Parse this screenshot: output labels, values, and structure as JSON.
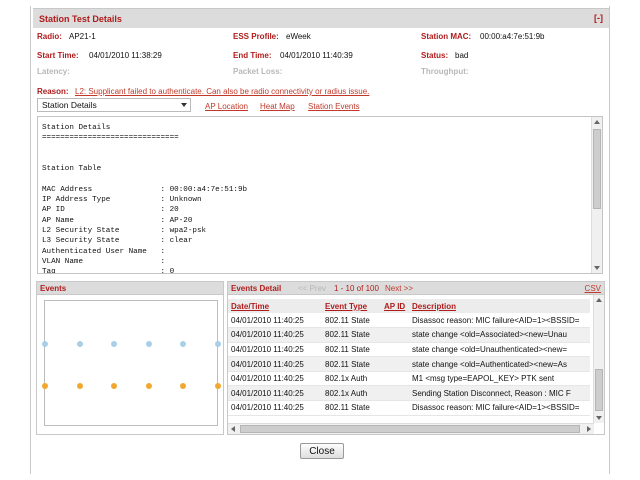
{
  "header": {
    "title": "Station Test Details",
    "collapse": "[-]"
  },
  "info": {
    "radio_label": "Radio:",
    "radio": "AP21-1",
    "ess_label": "ESS Profile:",
    "ess": "eWeek",
    "mac_label": "Station MAC:",
    "mac": "00:00:a4:7e:51:9b",
    "start_label": "Start Time:",
    "start": "04/01/2010 11:38:29",
    "end_label": "End Time:",
    "end": "04/01/2010 11:40:39",
    "status_label": "Status:",
    "status": "bad",
    "latency_label": "Latency:",
    "packet_loss_label": "Packet Loss:",
    "throughput_label": "Throughput:"
  },
  "reason": {
    "label": "Reason:",
    "text": "L2: Supplicant failed to authenticate. Can also be radio connectivity or radius issue."
  },
  "view_select": {
    "value": "Station Details"
  },
  "links": {
    "ap_location": "AP Location",
    "heat_map": "Heat Map",
    "station_events": "Station Events"
  },
  "details_text": "Station Details\n==============================\n\n\nStation Table\n\nMAC Address               : 00:00:a4:7e:51:9b\nIP Address Type           : Unknown\nAP ID                     : 20\nAP Name                   : AP-20\nL2 Security State         : wpa2-psk\nL3 Security State         : clear\nAuthenticated User Name   :\nVLAN Name                 :\nTag                       : 0",
  "events_panel": {
    "title": "Events",
    "rows": [
      {
        "name": "blue",
        "color": "#a9cfe8",
        "count": 6
      },
      {
        "name": "orange",
        "color": "#f0a830",
        "count": 6
      }
    ]
  },
  "events_detail": {
    "title": "Events Detail",
    "prev": "<< Prev",
    "range": "1 - 10 of 100",
    "next": "Next >>",
    "csv": "CSV",
    "columns": [
      "Date/Time",
      "Event Type",
      "AP ID",
      "Description"
    ],
    "rows": [
      [
        "04/01/2010 11:40:25",
        "802.11 State",
        "",
        "Disassoc reason: MIC failure<AID=1><BSSID="
      ],
      [
        "04/01/2010 11:40:25",
        "802.11 State",
        "",
        "state change <old=Associated><new=Unau"
      ],
      [
        "04/01/2010 11:40:25",
        "802.11 State",
        "",
        "state change <old=Unauthenticated><new="
      ],
      [
        "04/01/2010 11:40:25",
        "802.11 State",
        "",
        "state change <old=Authenticated><new=As"
      ],
      [
        "04/01/2010 11:40:25",
        "802.1x Auth",
        "",
        "M1 <msg type=EAPOL_KEY> PTK sent"
      ],
      [
        "04/01/2010 11:40:25",
        "802.1x Auth",
        "",
        "Sending Station Disconnect, Reason : MIC F"
      ],
      [
        "04/01/2010 11:40:25",
        "802.11 State",
        "",
        "Disassoc reason: MIC failure<AID=1><BSSID="
      ]
    ]
  },
  "footer": {
    "close": "Close"
  }
}
